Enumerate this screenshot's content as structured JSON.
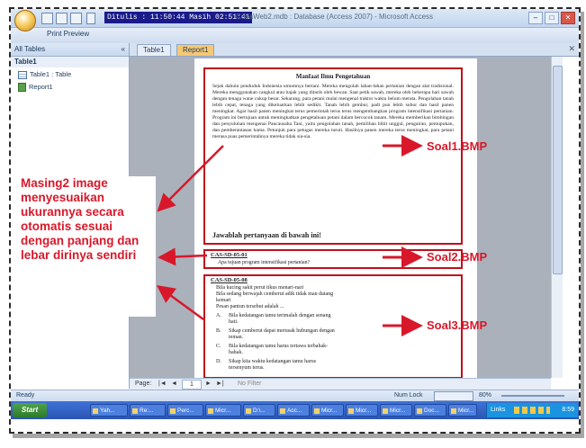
{
  "window": {
    "datetime": "Ditulis : 11:50:44  Masih 02:51:41",
    "title": "CobaWeb2.mdb : Database (Access 2007) - Microsoft Access",
    "ribbon_tab": "Print Preview",
    "min": "–",
    "max": "□",
    "close": "✕"
  },
  "nav": {
    "header": "All Tables",
    "header_arrow": "«",
    "group": "Table1",
    "items": [
      "Table1 : Table",
      "Report1"
    ]
  },
  "tabs": [
    "Table1",
    "Report1"
  ],
  "tab_close": "✕",
  "report": {
    "soal1": {
      "title": "Manfaat Ilmu Pengetahuan",
      "body": "Sejak dahulu penduduk Indonesia umumnya bertani. Mereka mengolah lahan-lahan pertanian dengan alat tradisional. Mereka menggunakan cangkul atau bajak yang ditarik oleh hewan. Saat petik sawah, mereka oleh beberapa hari sawah dengan tenaga wane cukup besar. Sekarang, para petani mulai mengenal traktor waktu belum merata. Pengolahan tanah lebih cepat, tenaga yang dikeluarkan lebih sedikit. Tanah lebih gembur, padi pun lebih subur dan hasil panen meningkat. Agar hasil panen meningkat terus pemerintah terus terus mengembangkan program intensifikasi pertanian. Program ini bertujuan untuk meningkatkan pengetahuan petani dalam bercocok tanam. Mereka memberikan bimbingan dan penyuluhan mengenai Pancausaha Tani, yaitu pengolahan tanah, pemilihan bibit unggul, pengairan, pemupukan, dan pemberantasan hama. Petunjuk para petugas mereka turuti. Hasilnya panen mereka terus meningkat, para petani merasa puas pemerintahnya mereka tidak sia-sia.",
      "question": "Jawablah pertanyaan di bawah ini!"
    },
    "soal2": {
      "code": "CAS-SD-05-01",
      "text": "Apa tujuan program intensifikasi pertanian?"
    },
    "soal3": {
      "code": "CAS-SD-05-08",
      "lines": [
        "Bila kucing sakit perut tikus menari-nari",
        "Bila sedang berwajah cemberut adik tidak mau datang",
        "kemari",
        "Pesan pantun tersebut adalah ..."
      ],
      "options": [
        {
          "letter": "A.",
          "line1": "Bila kedatangan tamu terimalah dengan senang",
          "line2": "hati."
        },
        {
          "letter": "B.",
          "line1": "Sikap cemberut dapat merusak hubungan dengan",
          "line2": "teman."
        },
        {
          "letter": "C.",
          "line1": "Bila kedatangan tamu harus tertawa terbahak-",
          "line2": "bahak."
        },
        {
          "letter": "D.",
          "line1": "Sikap kita waktu kedatangan tamu harus",
          "line2": "tersenyum terus."
        }
      ]
    }
  },
  "annotations": {
    "left_text": "Masing2 image menyesuaikan ukurannya secara otomatis sesuai dengan panjang dan lebar dirinya sendiri",
    "labels": [
      "Soal1.BMP",
      "Soal2.BMP",
      "Soal3.BMP"
    ],
    "color": "#d8182a"
  },
  "pagenav": {
    "label": "Page:",
    "first": "|◄",
    "prev": "◄",
    "page": "1",
    "next": "►",
    "last": "►|",
    "filter": "No Filter"
  },
  "status": {
    "left": "Ready",
    "numlock": "Num Lock",
    "zoom": "80%"
  },
  "taskbar": {
    "start": "Start",
    "items": [
      "Yah...",
      "Re:...",
      "Perc...",
      "Micr...",
      "D:\\...",
      "Acc...",
      "Micr...",
      "Micr...",
      "Micr...",
      "Doc...",
      "Micr...",
      "Links"
    ],
    "time": "8:59"
  }
}
